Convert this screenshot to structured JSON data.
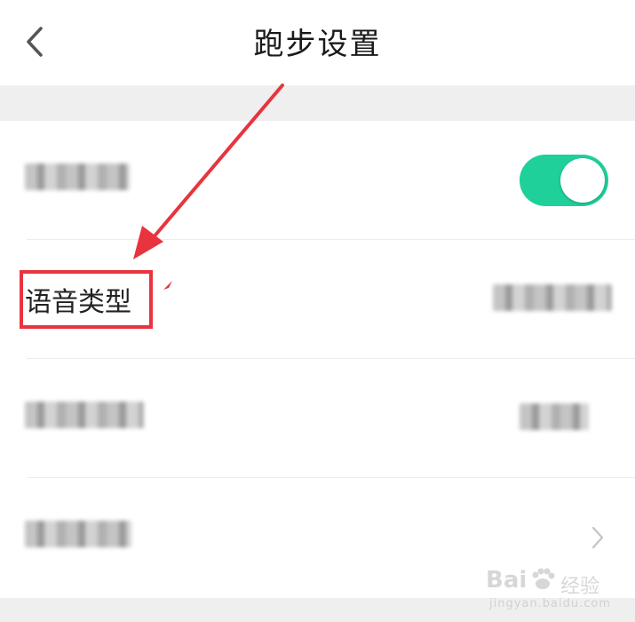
{
  "header": {
    "title": "跑步设置"
  },
  "rows": [
    {
      "label": "",
      "value": "",
      "control": "toggle",
      "toggle_on": true
    },
    {
      "label": "语音类型",
      "value": "",
      "control": "value"
    },
    {
      "label": "",
      "value": "",
      "control": "value"
    },
    {
      "label": "",
      "value": "",
      "control": "chevron"
    }
  ],
  "colors": {
    "toggle_on": "#1fd09b",
    "annotation_red": "#e8343e",
    "page_bg": "#f2f2f2"
  },
  "watermark": {
    "logo": "Bai",
    "cn": "经验",
    "url": "jingyan.baidu.com"
  }
}
